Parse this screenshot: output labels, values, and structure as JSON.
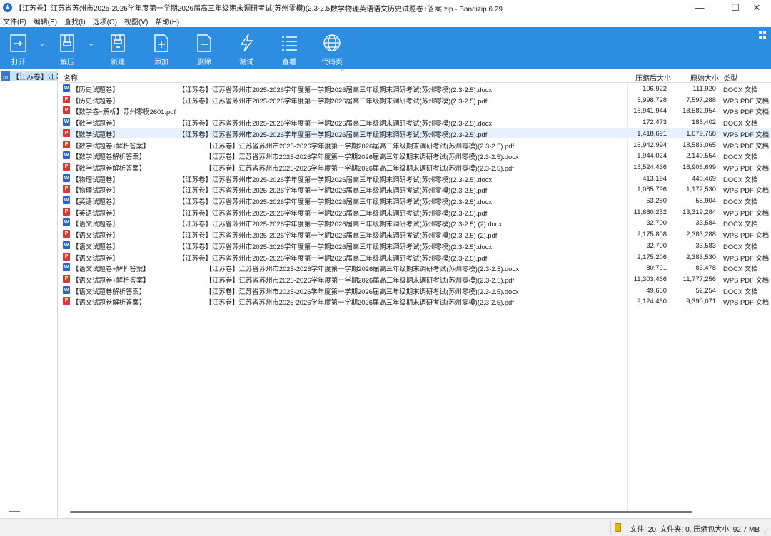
{
  "window": {
    "archive_title": "【江苏卷】江苏省苏州市2025-2026学年度第一学期2026届高三年级期末调研考试(苏州零模)(2.3-2.5)",
    "app_title": "数学物理英语语文历史试题卷+答案.zip - Bandizip 6.29",
    "minimize": "—",
    "maximize": "☐",
    "close": "✕"
  },
  "menu": [
    "文件(F)",
    "编辑(E)",
    "查找(I)",
    "选项(O)",
    "视图(V)",
    "帮助(H)"
  ],
  "toolbar": {
    "open": "打开",
    "extract": "解压",
    "new": "新建",
    "add": "添加",
    "delete": "删除",
    "test": "测试",
    "view": "查看",
    "codepage": "代码页"
  },
  "tree": {
    "root_label": "【江苏卷】江苏省苏州市"
  },
  "columns": {
    "name": "名称",
    "compressed": "压缩后大小",
    "original": "原始大小",
    "type": "类型"
  },
  "rows": [
    {
      "icon": "word",
      "name": "【历史试题卷】                                【江苏卷】江苏省苏州市2025-2026学年度第一学期2026届高三年级期末调研考试(苏州零模)(2.3-2.5).docx",
      "compressed": "106,922",
      "original": "111,920",
      "type": "DOCX 文档"
    },
    {
      "icon": "pdf",
      "name": "【历史试题卷】                                【江苏卷】江苏省苏州市2025-2026学年度第一学期2026届高三年级期末调研考试(苏州零模)(2.3-2.5).pdf",
      "compressed": "5,998,728",
      "original": "7,597,288",
      "type": "WPS PDF 文档"
    },
    {
      "icon": "pdf",
      "name": "【数学卷+解析】苏州零模2601.pdf",
      "compressed": "16,941,944",
      "original": "18,582,954",
      "type": "WPS PDF 文档"
    },
    {
      "icon": "word",
      "name": "【数学试题卷】                                【江苏卷】江苏省苏州市2025-2026学年度第一学期2026届高三年级期末调研考试(苏州零模)(2.3-2.5).docx",
      "compressed": "172,473",
      "original": "186,402",
      "type": "DOCX 文档"
    },
    {
      "icon": "pdf",
      "name": "【数学试题卷】                                【江苏卷】江苏省苏州市2025-2026学年度第一学期2026届高三年级期末调研考试(苏州零模)(2.3-2.5).pdf",
      "compressed": "1,418,691",
      "original": "1,679,758",
      "type": "WPS PDF 文档",
      "hl": true
    },
    {
      "icon": "pdf",
      "name": "【数学试题卷+解析答案】                              【江苏卷】江苏省苏州市2025-2026学年度第一学期2026届高三年级期末调研考试(苏州零模)(2.3-2.5).pdf",
      "compressed": "16,942,994",
      "original": "18,583,065",
      "type": "WPS PDF 文档"
    },
    {
      "icon": "word",
      "name": "【数学试题卷解析答案】                                【江苏卷】江苏省苏州市2025-2026学年度第一学期2026届高三年级期末调研考试(苏州零模)(2.3-2.5).docx",
      "compressed": "1,944,024",
      "original": "2,140,554",
      "type": "DOCX 文档"
    },
    {
      "icon": "pdf",
      "name": "【数学试题卷解析答案】                                【江苏卷】江苏省苏州市2025-2026学年度第一学期2026届高三年级期末调研考试(苏州零模)(2.3-2.5).pdf",
      "compressed": "15,524,436",
      "original": "16,906,699",
      "type": "WPS PDF 文档"
    },
    {
      "icon": "word",
      "name": "【物理试题卷】                                【江苏卷】江苏省苏州市2025-2026学年度第一学期2026届高三年级期末调研考试(苏州零模)(2.3-2.5).docx",
      "compressed": "413,194",
      "original": "448,469",
      "type": "DOCX 文档"
    },
    {
      "icon": "pdf",
      "name": "【物理试题卷】                                【江苏卷】江苏省苏州市2025-2026学年度第一学期2026届高三年级期末调研考试(苏州零模)(2.3-2.5).pdf",
      "compressed": "1,085,796",
      "original": "1,172,530",
      "type": "WPS PDF 文档"
    },
    {
      "icon": "word",
      "name": "【英语试题卷】                                【江苏卷】江苏省苏州市2025-2026学年度第一学期2026届高三年级期末调研考试(苏州零模)(2.3-2.5).docx",
      "compressed": "53,280",
      "original": "55,904",
      "type": "DOCX 文档"
    },
    {
      "icon": "pdf",
      "name": "【英语试题卷】                                【江苏卷】江苏省苏州市2025-2026学年度第一学期2026届高三年级期末调研考试(苏州零模)(2.3-2.5).pdf",
      "compressed": "11,660,252",
      "original": "13,319,284",
      "type": "WPS PDF 文档"
    },
    {
      "icon": "word",
      "name": "【语文试题卷】                                【江苏卷】江苏省苏州市2025-2026学年度第一学期2026届高三年级期末调研考试(苏州零模)(2.3-2.5) (2).docx",
      "compressed": "32,700",
      "original": "33,584",
      "type": "DOCX 文档"
    },
    {
      "icon": "pdf",
      "name": "【语文试题卷】                                【江苏卷】江苏省苏州市2025-2026学年度第一学期2026届高三年级期末调研考试(苏州零模)(2.3-2.5) (2).pdf",
      "compressed": "2,175,808",
      "original": "2,383,288",
      "type": "WPS PDF 文档"
    },
    {
      "icon": "word",
      "name": "【语文试题卷】                                【江苏卷】江苏省苏州市2025-2026学年度第一学期2026届高三年级期末调研考试(苏州零模)(2.3-2.5).docx",
      "compressed": "32,700",
      "original": "33,583",
      "type": "DOCX 文档"
    },
    {
      "icon": "pdf",
      "name": "【语文试题卷】                                【江苏卷】江苏省苏州市2025-2026学年度第一学期2026届高三年级期末调研考试(苏州零模)(2.3-2.5).pdf",
      "compressed": "2,175,206",
      "original": "2,383,530",
      "type": "WPS PDF 文档"
    },
    {
      "icon": "word",
      "name": "【语文试题卷+解析答案】                              【江苏卷】江苏省苏州市2025-2026学年度第一学期2026届高三年级期末调研考试(苏州零模)(2.3-2.5).docx",
      "compressed": "80,791",
      "original": "83,478",
      "type": "DOCX 文档"
    },
    {
      "icon": "pdf",
      "name": "【语文试题卷+解析答案】                              【江苏卷】江苏省苏州市2025-2026学年度第一学期2026届高三年级期末调研考试(苏州零模)(2.3-2.5).pdf",
      "compressed": "11,303,466",
      "original": "11,777,256",
      "type": "WPS PDF 文档"
    },
    {
      "icon": "word",
      "name": "【语文试题卷解析答案】                                【江苏卷】江苏省苏州市2025-2026学年度第一学期2026届高三年级期末调研考试(苏州零模)(2.3-2.5).docx",
      "compressed": "49,650",
      "original": "52,254",
      "type": "DOCX 文档"
    },
    {
      "icon": "pdf",
      "name": "【语文试题卷解析答案】                                【江苏卷】江苏省苏州市2025-2026学年度第一学期2026届高三年级期末调研考试(苏州零模)(2.3-2.5).pdf",
      "compressed": "9,124,460",
      "original": "9,390,071",
      "type": "WPS PDF 文档"
    }
  ],
  "status": {
    "text": "文件: 20, 文件夹: 0, 压缩包大小: 92.7 MB"
  },
  "colors": {
    "toolbar": "#2d8de0",
    "selection": "#cce4f7",
    "word_icon": "#2b63c4",
    "pdf_icon": "#d23b31"
  }
}
